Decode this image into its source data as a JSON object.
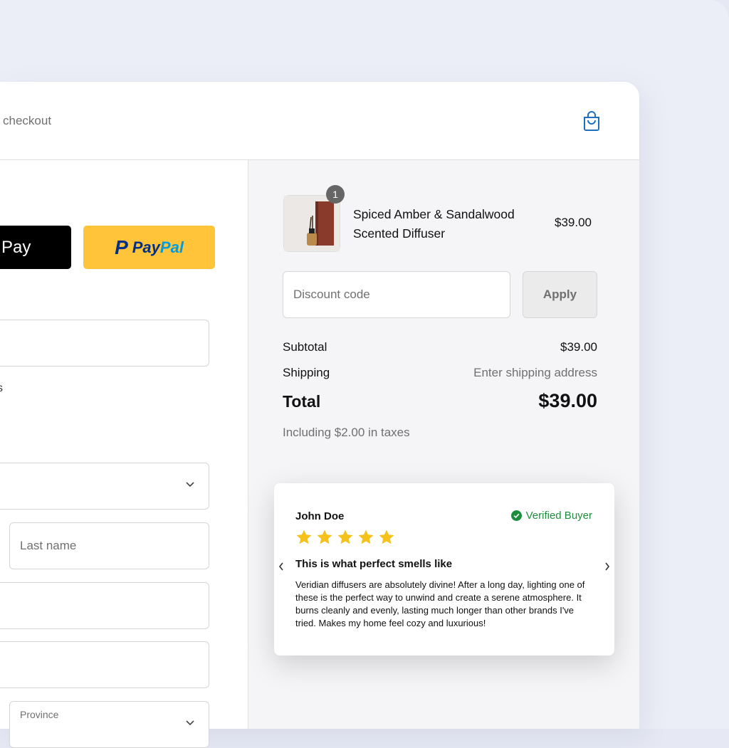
{
  "express_checkout": {
    "label": "checkout",
    "gpay_label": "Pay",
    "paypal_label_1": "Pay",
    "paypal_label_2": "Pal"
  },
  "form": {
    "cut_text": "s",
    "last_name_placeholder": "Last name",
    "province_label": "Province"
  },
  "cart_icon": "shopping-bag-icon",
  "order": {
    "item": {
      "name": "Spiced Amber & Sandalwood Scented Diffuser",
      "price": "$39.00",
      "quantity": "1"
    },
    "discount_placeholder": "Discount code",
    "apply_label": "Apply",
    "subtotal_label": "Subtotal",
    "subtotal_value": "$39.00",
    "shipping_label": "Shipping",
    "shipping_value": "Enter shipping address",
    "total_label": "Total",
    "total_value": "$39.00",
    "tax_note": "Including $2.00 in taxes"
  },
  "review": {
    "name": "John Doe",
    "badge": "Verified Buyer",
    "rating": 5,
    "title": "This is what perfect smells like",
    "body": "Veridian diffusers are absolutely divine! After a long day, lighting one of these is the perfect way to unwind and create a serene atmosphere. It burns cleanly and evenly, lasting much longer than other brands I've tried. Makes my home feel cozy and luxurious!"
  },
  "colors": {
    "accent": "#1f6fbf",
    "paypal_yellow": "#ffc439",
    "star": "#f4c21b",
    "verified_green": "#1e8e3e"
  }
}
